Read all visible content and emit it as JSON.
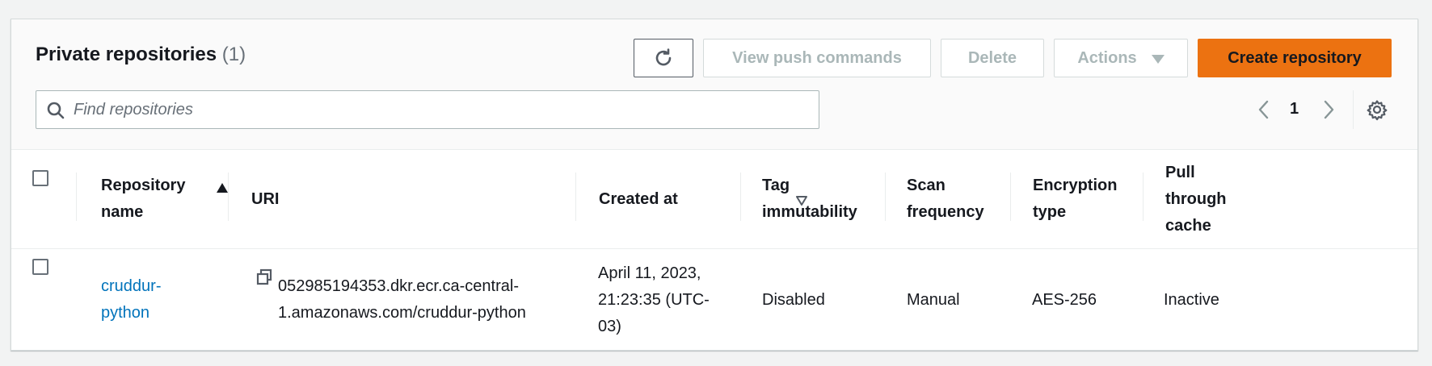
{
  "header": {
    "title": "Private repositories",
    "count": "(1)"
  },
  "toolbar": {
    "push_label": "View push commands",
    "delete_label": "Delete",
    "actions_label": "Actions",
    "create_label": "Create repository"
  },
  "search": {
    "placeholder": "Find repositories",
    "value": ""
  },
  "pagination": {
    "page": "1"
  },
  "table": {
    "headers": {
      "name_line1": "Repository",
      "name_line2": "name",
      "uri": "URI",
      "created": "Created at",
      "tag_line1": "Tag",
      "tag_line2": "immutability",
      "scan_line1": "Scan",
      "scan_line2": "frequency",
      "enc_line1": "Encryption",
      "enc_line2": "type",
      "pull_line1": "Pull",
      "pull_line2": "through",
      "pull_line3": "cache"
    },
    "rows": [
      {
        "name_line1": "cruddur-",
        "name_line2": "python",
        "uri_line1": "052985194353.dkr.ecr.ca-central-",
        "uri_line2": "1.amazonaws.com/cruddur-python",
        "created_line1": "April 11, 2023,",
        "created_line2": "21:23:35 (UTC-",
        "created_line3": "03)",
        "tag_immutability": "Disabled",
        "scan_frequency": "Manual",
        "encryption_type": "AES-256",
        "pull_through_cache": "Inactive"
      }
    ]
  },
  "icons": {
    "refresh": "refresh-icon",
    "search": "search-icon",
    "prev": "chevron-left-icon",
    "next": "chevron-right-icon",
    "settings": "gear-icon",
    "copy": "copy-icon"
  },
  "colors": {
    "primary_button": "#ec7211",
    "link": "#0073bb",
    "disabled_text": "#aab7b8"
  }
}
